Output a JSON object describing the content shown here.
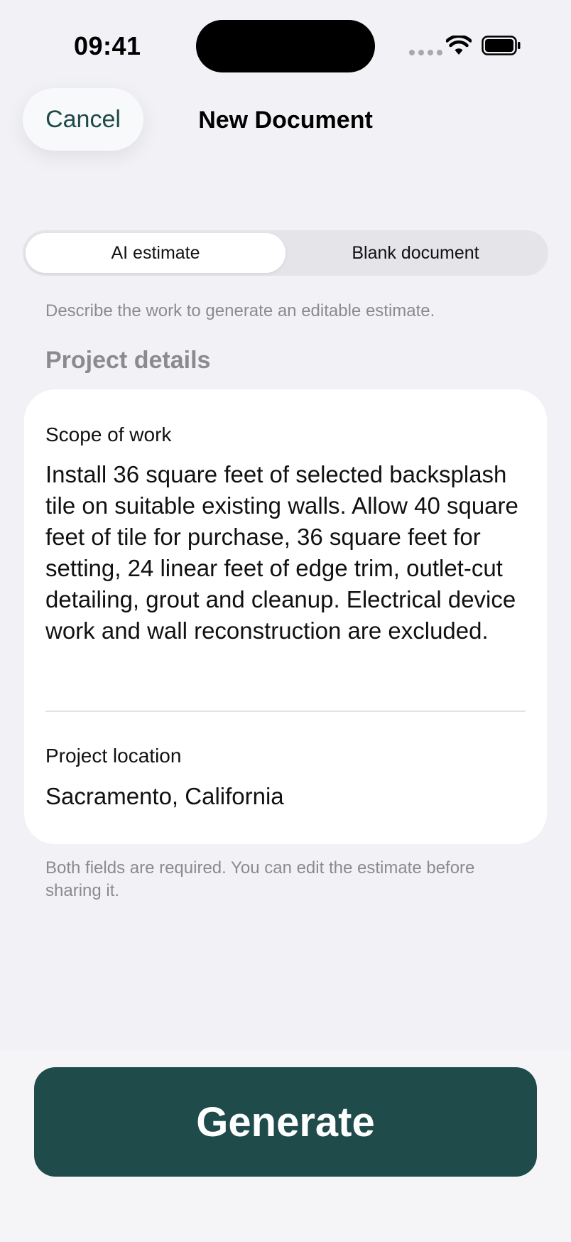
{
  "status_bar": {
    "time": "09:41"
  },
  "nav": {
    "cancel_label": "Cancel",
    "title": "New Document"
  },
  "mode_toggle": {
    "options": [
      "AI estimate",
      "Blank document"
    ],
    "selected": "AI estimate"
  },
  "hint": "Describe the work to generate an editable estimate.",
  "section_title": "Project details",
  "form": {
    "scope_label": "Scope of work",
    "scope_value": "Install 36 square feet of selected backsplash tile on suitable existing walls. Allow 40 square feet of tile for purchase, 36 square feet for setting, 24 linear feet of edge trim, outlet-cut detailing, grout and cleanup. Electrical device work and wall reconstruction are excluded.",
    "location_label": "Project location",
    "location_value": "Sacramento, California"
  },
  "footnote": "Both fields are required. You can edit the estimate before sharing it.",
  "generate_label": "Generate",
  "colors": {
    "accent": "#1f4b4a",
    "background": "#f2f2f6",
    "secondary_text": "#8a8a8f"
  },
  "icons": [
    "cellular-dots-icon",
    "wifi-icon",
    "battery-icon"
  ]
}
